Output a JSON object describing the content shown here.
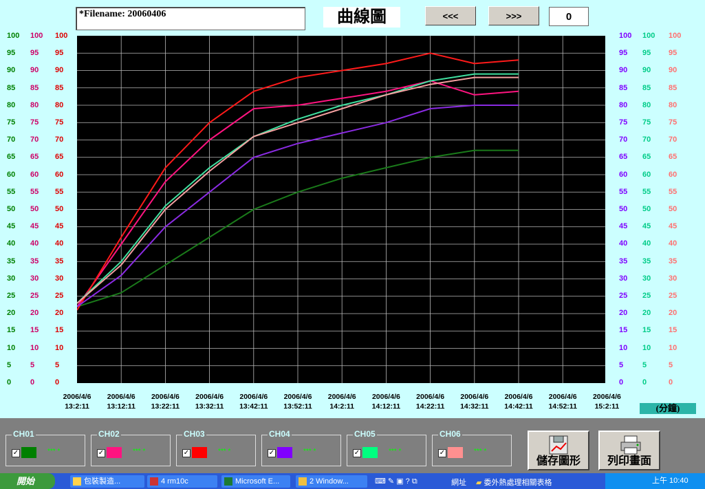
{
  "header": {
    "filename": "*Filename: 20060406",
    "title": "曲線圖",
    "prev_label": "<<<",
    "next_label": ">>>",
    "page_value": "0"
  },
  "axes": {
    "y_ticks": [
      "100",
      "95",
      "90",
      "85",
      "80",
      "75",
      "70",
      "65",
      "60",
      "55",
      "50",
      "45",
      "40",
      "35",
      "30",
      "25",
      "20",
      "15",
      "10",
      "5",
      "0"
    ],
    "left_colors": [
      "#008000",
      "#cc0066",
      "#dd0000"
    ],
    "right_colors": [
      "#8000ff",
      "#00cc88",
      "#ff7070"
    ],
    "x_dates": [
      "2006/4/6",
      "2006/4/6",
      "2006/4/6",
      "2006/4/6",
      "2006/4/6",
      "2006/4/6",
      "2006/4/6",
      "2006/4/6",
      "2006/4/6",
      "2006/4/6",
      "2006/4/6",
      "2006/4/6",
      "2006/4/6"
    ],
    "x_times": [
      "13:2:11",
      "13:12:11",
      "13:22:11",
      "13:32:11",
      "13:42:11",
      "13:52:11",
      "14:2:11",
      "14:12:11",
      "14:22:11",
      "14:32:11",
      "14:42:11",
      "14:52:11",
      "15:2:11"
    ],
    "unit_label": "(分鐘)"
  },
  "chart_data": {
    "type": "line",
    "categories": [
      "13:2:11",
      "13:12:11",
      "13:22:11",
      "13:32:11",
      "13:42:11",
      "13:52:11",
      "14:2:11",
      "14:12:11",
      "14:22:11",
      "14:32:11",
      "14:42:11"
    ],
    "ylim": [
      0,
      100
    ],
    "grid": true,
    "series": [
      {
        "name": "CH01",
        "color": "#1a7a1a",
        "values": [
          22,
          26,
          34,
          42,
          50,
          55,
          59,
          62,
          65,
          67,
          67
        ]
      },
      {
        "name": "CH02",
        "color": "#ff1480",
        "values": [
          22,
          40,
          58,
          70,
          79,
          80,
          82,
          84,
          87,
          83,
          84
        ]
      },
      {
        "name": "CH03",
        "color": "#ff1a1a",
        "values": [
          21,
          42,
          62,
          75,
          84,
          88,
          90,
          92,
          95,
          92,
          93
        ]
      },
      {
        "name": "CH04",
        "color": "#8a2be2",
        "values": [
          22,
          31,
          45,
          55,
          65,
          69,
          72,
          75,
          79,
          80,
          80
        ]
      },
      {
        "name": "CH05",
        "color": "#40e0a0",
        "values": [
          23,
          35,
          51,
          62,
          71,
          76,
          80,
          83,
          87,
          89,
          89
        ]
      },
      {
        "name": "CH06",
        "color": "#f4a0a0",
        "values": [
          23,
          34,
          50,
          61,
          71,
          75,
          79,
          83,
          86,
          88,
          88
        ]
      }
    ]
  },
  "channels": [
    {
      "label": "CH01",
      "color": "#008000",
      "value": "*** *"
    },
    {
      "label": "CH02",
      "color": "#ff1480",
      "value": "*** *"
    },
    {
      "label": "CH03",
      "color": "#ff0000",
      "value": "*** *"
    },
    {
      "label": "CH04",
      "color": "#8000ff",
      "value": "*** *"
    },
    {
      "label": "CH05",
      "color": "#00ff80",
      "value": "*** *"
    },
    {
      "label": "CH06",
      "color": "#ff9090",
      "value": "*** *"
    }
  ],
  "buttons": {
    "save_label": "儲存圖形",
    "print_label": "列印畫面"
  },
  "taskbar": {
    "start_label": "開始",
    "tasks": [
      "包裝製造...",
      "4 rm10c",
      "Microsoft E...",
      "2 Window..."
    ],
    "address_label": "網址",
    "folder_label": "委外熱處理相關表格",
    "clock": "上午 10:40"
  }
}
